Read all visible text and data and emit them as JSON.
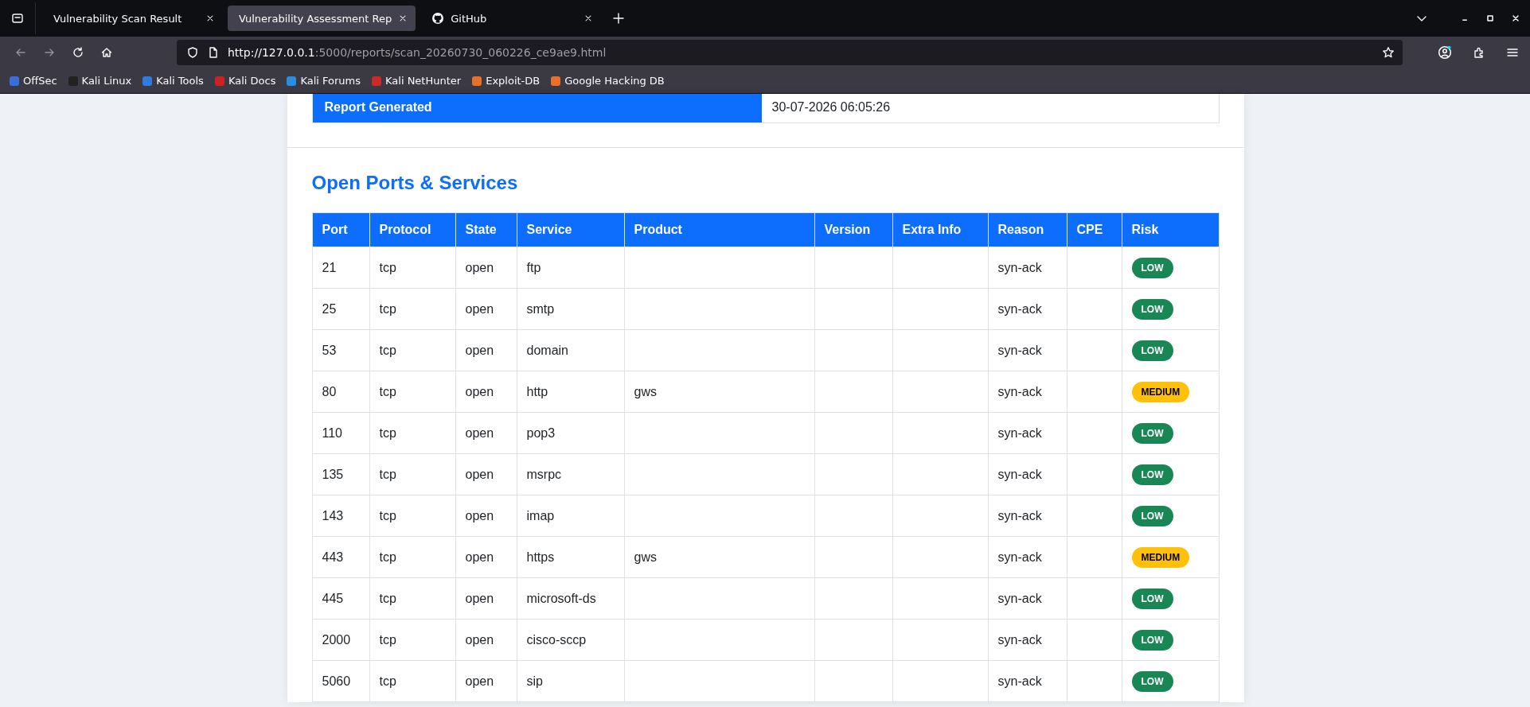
{
  "browser": {
    "tabs": [
      {
        "title": "Vulnerability Scan Result",
        "selected": false,
        "kind": "page"
      },
      {
        "title": "Vulnerability Assessment Rep",
        "selected": true,
        "kind": "page"
      },
      {
        "title": "GitHub",
        "selected": false,
        "kind": "github"
      }
    ],
    "url_host": "http://127.0.0.1",
    "url_rest": ":5000/reports/scan_20260730_060226_ce9ae9.html",
    "bookmarks": [
      {
        "label": "OffSec",
        "color": "#3b6fd8"
      },
      {
        "label": "Kali Linux",
        "color": "#222222"
      },
      {
        "label": "Kali Tools",
        "color": "#2f7be0"
      },
      {
        "label": "Kali Docs",
        "color": "#cc2222"
      },
      {
        "label": "Kali Forums",
        "color": "#2a8ee0"
      },
      {
        "label": "Kali NetHunter",
        "color": "#d02828"
      },
      {
        "label": "Exploit-DB",
        "color": "#e8702a"
      },
      {
        "label": "Google Hacking DB",
        "color": "#e8702a"
      }
    ]
  },
  "summary_row": {
    "label": "Report Generated",
    "value": "30-07-2026 06:05:26"
  },
  "section_title": "Open Ports & Services",
  "table": {
    "columns": [
      "Port",
      "Protocol",
      "State",
      "Service",
      "Product",
      "Version",
      "Extra Info",
      "Reason",
      "CPE",
      "Risk"
    ],
    "rows": [
      {
        "port": "21",
        "protocol": "tcp",
        "state": "open",
        "service": "ftp",
        "product": "",
        "reason": "syn-ack",
        "risk": "LOW",
        "color": "#198754"
      },
      {
        "port": "25",
        "protocol": "tcp",
        "state": "open",
        "service": "smtp",
        "product": "",
        "reason": "syn-ack",
        "risk": "LOW",
        "color": "#198754"
      },
      {
        "port": "53",
        "protocol": "tcp",
        "state": "open",
        "service": "domain",
        "product": "",
        "reason": "syn-ack",
        "risk": "LOW",
        "color": "#198754"
      },
      {
        "port": "80",
        "protocol": "tcp",
        "state": "open",
        "service": "http",
        "product": "gws",
        "reason": "syn-ack",
        "risk": "MEDIUM",
        "color": "#ffc107"
      },
      {
        "port": "110",
        "protocol": "tcp",
        "state": "open",
        "service": "pop3",
        "product": "",
        "reason": "syn-ack",
        "risk": "LOW",
        "color": "#198754"
      },
      {
        "port": "135",
        "protocol": "tcp",
        "state": "open",
        "service": "msrpc",
        "product": "",
        "reason": "syn-ack",
        "risk": "LOW",
        "color": "#198754"
      },
      {
        "port": "143",
        "protocol": "tcp",
        "state": "open",
        "service": "imap",
        "product": "",
        "reason": "syn-ack",
        "risk": "LOW",
        "color": "#198754"
      },
      {
        "port": "443",
        "protocol": "tcp",
        "state": "open",
        "service": "https",
        "product": "gws",
        "reason": "syn-ack",
        "risk": "MEDIUM",
        "color": "#ffc107"
      },
      {
        "port": "445",
        "protocol": "tcp",
        "state": "open",
        "service": "microsoft-ds",
        "product": "",
        "reason": "syn-ack",
        "risk": "LOW",
        "color": "#198754"
      },
      {
        "port": "2000",
        "protocol": "tcp",
        "state": "open",
        "service": "cisco-sccp",
        "product": "",
        "reason": "syn-ack",
        "risk": "LOW",
        "color": "#198754"
      },
      {
        "port": "5060",
        "protocol": "tcp",
        "state": "open",
        "service": "sip",
        "product": "",
        "reason": "syn-ack",
        "risk": "LOW",
        "color": "#198754"
      }
    ]
  }
}
